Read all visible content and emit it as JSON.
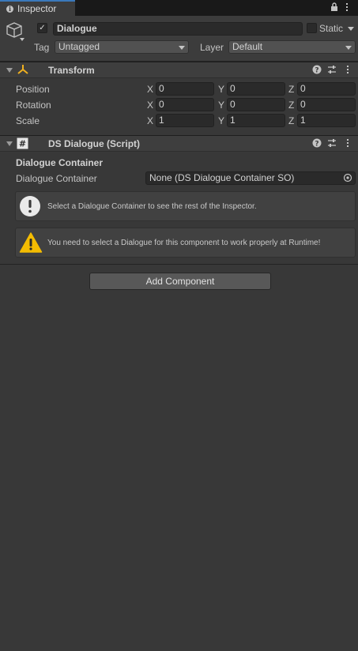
{
  "tab": {
    "title": "Inspector"
  },
  "object": {
    "name": "Dialogue",
    "active": true,
    "static_label": "Static",
    "tag_label": "Tag",
    "tag_value": "Untagged",
    "layer_label": "Layer",
    "layer_value": "Default"
  },
  "transform": {
    "title": "Transform",
    "rows": [
      {
        "label": "Position",
        "x": "0",
        "y": "0",
        "z": "0"
      },
      {
        "label": "Rotation",
        "x": "0",
        "y": "0",
        "z": "0"
      },
      {
        "label": "Scale",
        "x": "1",
        "y": "1",
        "z": "1"
      }
    ],
    "axis": {
      "x": "X",
      "y": "Y",
      "z": "Z"
    }
  },
  "script": {
    "title": "DS Dialogue (Script)",
    "section_header": "Dialogue Container",
    "field_label": "Dialogue Container",
    "field_value": "None (DS Dialogue Container SO)",
    "info_message": "Select a Dialogue Container to see the rest of the Inspector.",
    "warning_message": "You need to select a Dialogue for this component to work properly at Runtime!"
  },
  "add_component_label": "Add Component",
  "colors": {
    "background": "#383838",
    "accent_tab": "#3a79bb",
    "warning": "#f4bc02"
  }
}
